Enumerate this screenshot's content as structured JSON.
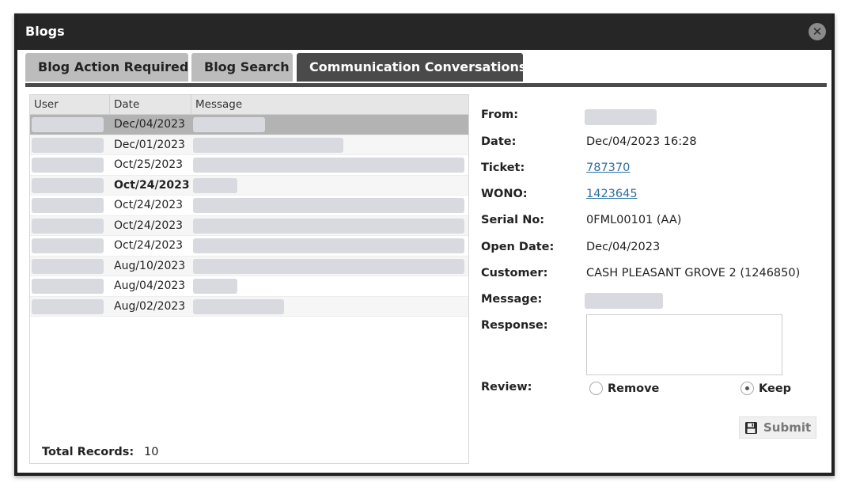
{
  "window": {
    "title": "Blogs",
    "close_icon": "close-icon"
  },
  "tabs": [
    {
      "label": "Blog Action Required"
    },
    {
      "label": "Blog Search"
    },
    {
      "label": "Communication Conversations",
      "active": true
    }
  ],
  "grid": {
    "columns": [
      "User",
      "Date",
      "Message"
    ],
    "rows": [
      {
        "date": "Dec/04/2023",
        "selected": true
      },
      {
        "date": "Dec/01/2023"
      },
      {
        "date": "Oct/25/2023"
      },
      {
        "date": "Oct/24/2023",
        "bold": true
      },
      {
        "date": "Oct/24/2023"
      },
      {
        "date": "Oct/24/2023"
      },
      {
        "date": "Oct/24/2023"
      },
      {
        "date": "Aug/10/2023"
      },
      {
        "date": "Aug/04/2023"
      },
      {
        "date": "Aug/02/2023"
      }
    ],
    "total_label": "Total Records:",
    "total_value": "10"
  },
  "detail": {
    "from_label": "From:",
    "date_label": "Date:",
    "date_value": "Dec/04/2023 16:28",
    "ticket_label": "Ticket:",
    "ticket_value": "787370",
    "wono_label": "WONO:",
    "wono_value": "1423645",
    "serial_label": "Serial No:",
    "serial_value": "0FML00101 (AA)",
    "open_date_label": "Open Date:",
    "open_date_value": "Dec/04/2023",
    "customer_label": "Customer:",
    "customer_value": "CASH PLEASANT GROVE 2 (1246850)",
    "message_label": "Message:",
    "response_label": "Response:",
    "review_label": "Review:",
    "review_options": [
      {
        "label": "Remove",
        "checked": false
      },
      {
        "label": "Keep",
        "checked": true
      }
    ],
    "submit_label": "Submit",
    "submit_icon": "save-icon"
  }
}
